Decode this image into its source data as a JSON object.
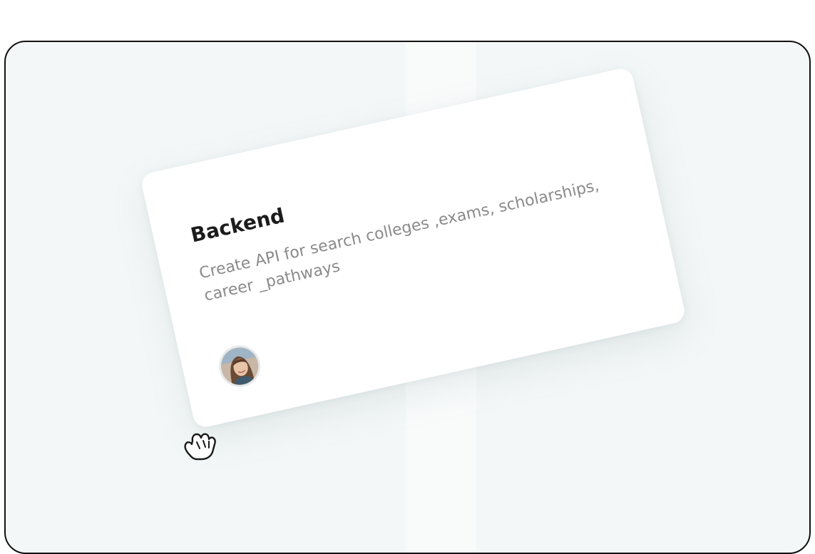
{
  "card": {
    "title": "Backend",
    "description": "Create API for search colleges ,exams, scholarships, career _pathways"
  },
  "icons": {
    "avatar": "assignee-avatar",
    "cursor": "grab-hand-cursor-icon"
  },
  "colors": {
    "board_background": "#f3f7f7",
    "card_background": "#ffffff",
    "title_text": "#1c1c1c",
    "description_text": "#8a8a8a"
  }
}
